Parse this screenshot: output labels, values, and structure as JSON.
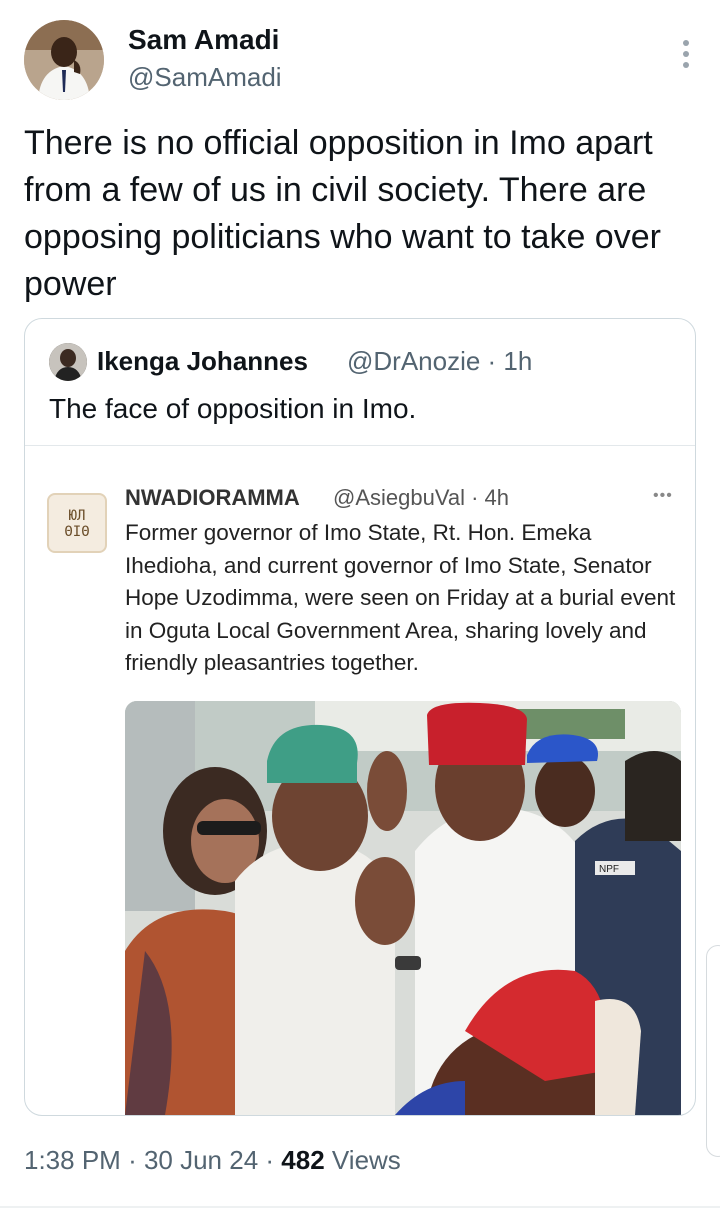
{
  "tweet": {
    "author_name": "Sam Amadi",
    "author_handle": "@SamAmadi",
    "more_icon": "more-vertical-icon",
    "text": "There is no official opposition in Imo apart from a few of us in civil society. There are opposing politicians who want to take over power",
    "time": "1:38 PM",
    "date": "30 Jun 24",
    "views_count": "482",
    "views_label": "Views"
  },
  "quote": {
    "author_name": "Ikenga Johannes",
    "author_handle": "@DrAnozie · 1h",
    "text": "The face of opposition in Imo."
  },
  "inner": {
    "author_name": "NWADIORAMMA",
    "author_handle": "@AsiegbuVal · 4h",
    "more": "•••",
    "logo_text_top": "ЮЛ",
    "logo_text_bottom": "ΘIΘ",
    "text": "Former governor of Imo State, Rt. Hon. Emeka Ihedioha, and current governor of Imo State, Senator Hope Uzodimma, were seen on Friday at a burial event in Oguta Local Government Area, sharing lovely and friendly pleasantries together.",
    "photo_badge": "NPF"
  },
  "colors": {
    "text": "#0f1419",
    "secondary": "#536471",
    "border": "#cfd9de",
    "green_cap": "#3f9e86",
    "red_cap": "#c8202c",
    "white_attire": "#f3f3f1",
    "police_blue": "#2b56c9"
  }
}
